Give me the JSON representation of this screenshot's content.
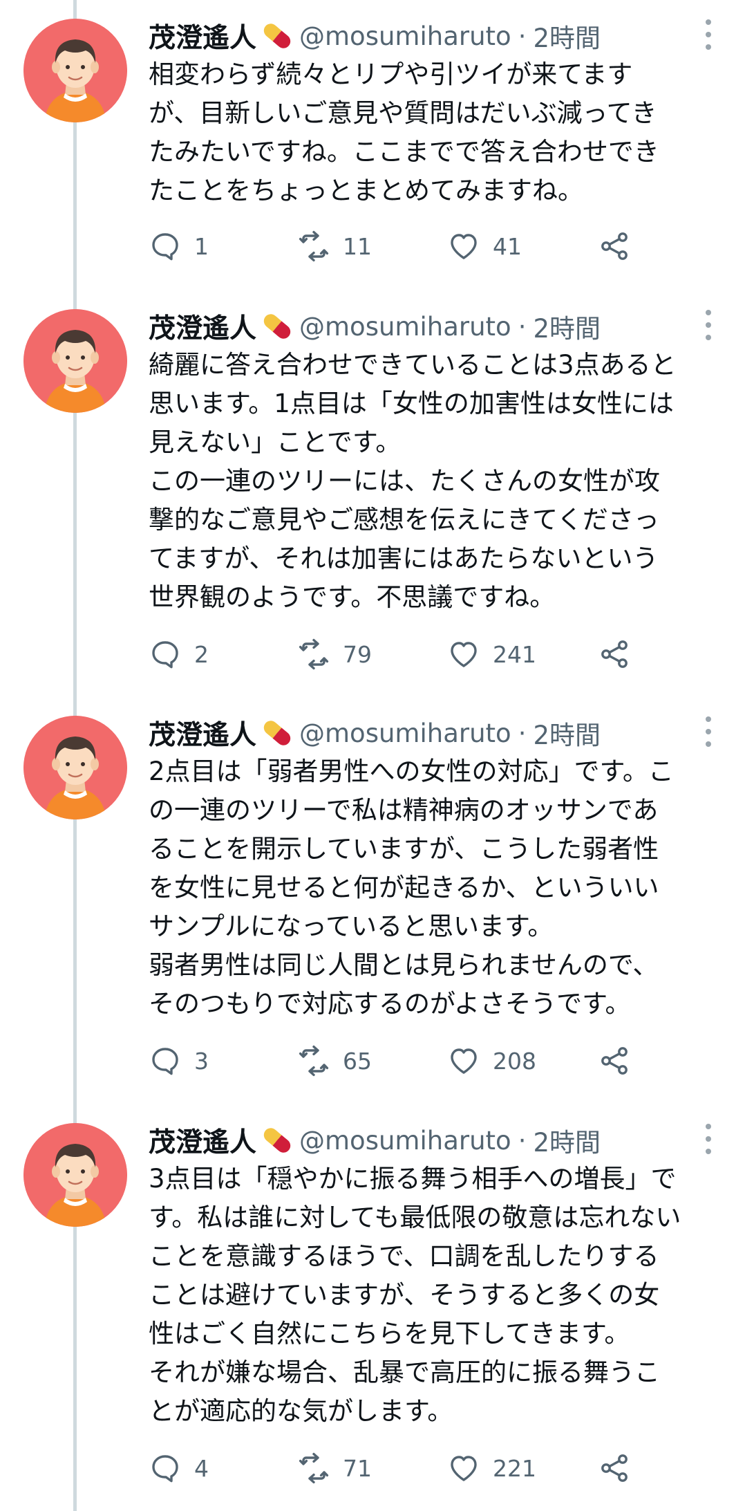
{
  "author": {
    "name": "茂澄遙人",
    "handle": "@mosumiharuto",
    "separator": "·"
  },
  "colors": {
    "avatar_bg": "#f26a6a",
    "thread_line": "#cfd9de",
    "text": "#0f1419",
    "muted": "#536471",
    "pill_yellow": "#f4c542",
    "pill_red": "#d01e3a"
  },
  "icons": {
    "reply": "reply-icon",
    "retweet": "retweet-icon",
    "like": "heart-icon",
    "share": "share-icon",
    "more": "more-vertical-icon",
    "badge": "pill-emoji-icon"
  },
  "tweets": [
    {
      "time": "2時間",
      "lines": [
        "相変わらず続々とリプや引ツイが来てます",
        "が、目新しいご意見や質問はだいぶ減ってき",
        "たみたいですね。ここまでで答え合わせでき",
        "たことをちょっとまとめてみますね。"
      ],
      "replies": "1",
      "retweets": "11",
      "likes": "41"
    },
    {
      "time": "2時間",
      "lines": [
        "綺麗に答え合わせできていることは3点あると",
        "思います。1点目は「女性の加害性は女性には",
        "見えない」ことです。",
        "この一連のツリーには、たくさんの女性が攻",
        "撃的なご意見やご感想を伝えにきてくださっ",
        "てますが、それは加害にはあたらないという",
        "世界観のようです。不思議ですね。"
      ],
      "replies": "2",
      "retweets": "79",
      "likes": "241"
    },
    {
      "time": "2時間",
      "lines": [
        "2点目は「弱者男性への女性の対応」です。こ",
        "の一連のツリーで私は精神病のオッサンであ",
        "ることを開示していますが、こうした弱者性",
        "を女性に見せると何が起きるか、といういい",
        "サンプルになっていると思います。",
        "弱者男性は同じ人間とは見られませんので、",
        "そのつもりで対応するのがよさそうです。"
      ],
      "replies": "3",
      "retweets": "65",
      "likes": "208"
    },
    {
      "time": "2時間",
      "lines": [
        "3点目は「穏やかに振る舞う相手への増長」で",
        "す。私は誰に対しても最低限の敬意は忘れない",
        "ことを意識するほうで、口調を乱したりする",
        "ことは避けていますが、そうすると多くの女",
        "性はごく自然にこちらを見下してきます。",
        "それが嫌な場合、乱暴で高圧的に振る舞うこ",
        "とが適応的な気がします。"
      ],
      "replies": "4",
      "retweets": "71",
      "likes": "221"
    }
  ]
}
